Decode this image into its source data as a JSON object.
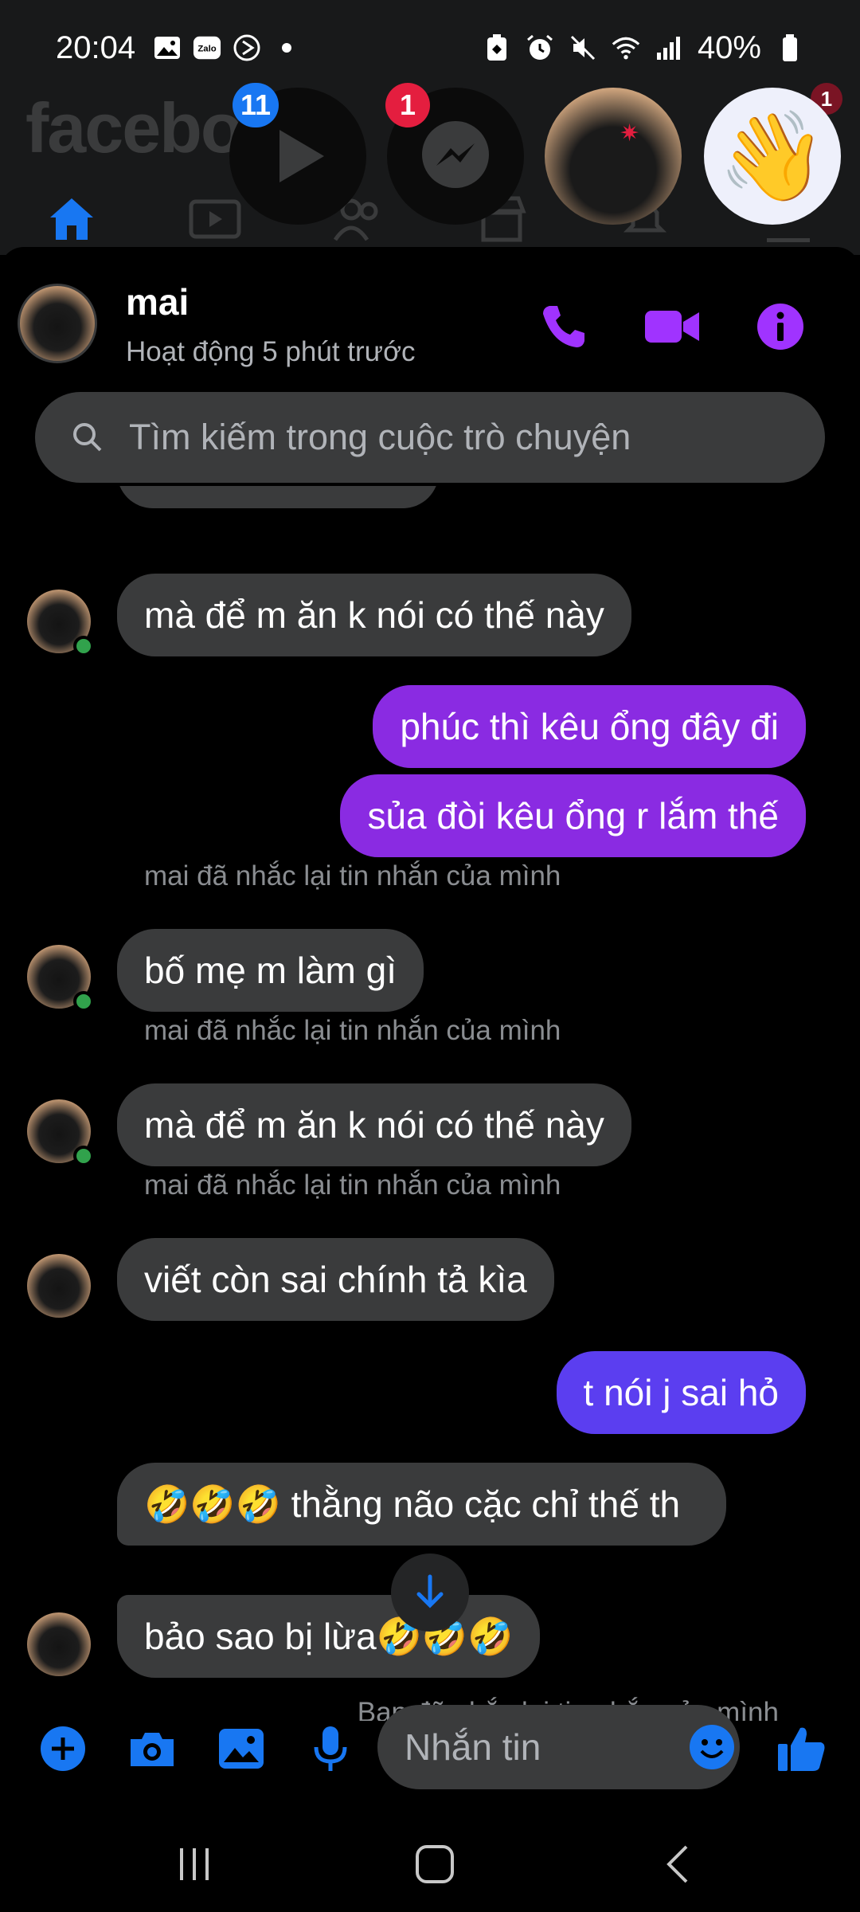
{
  "status_bar": {
    "time": "20:04",
    "battery": "40%",
    "left_icons": [
      "gallery-icon",
      "zalo-icon",
      "media-icon",
      "dot-icon"
    ],
    "right_icons": [
      "battery-saver-icon",
      "alarm-icon",
      "mute-icon",
      "wifi-icon",
      "signal-icon",
      "battery-icon"
    ]
  },
  "background_app": {
    "logo": "facebo",
    "nav_icons": [
      "home-icon",
      "video-icon",
      "friends-icon",
      "marketplace-icon",
      "bell-icon",
      "menu-icon"
    ],
    "notif_badge": "1"
  },
  "chat_heads": [
    {
      "icon": "play-icon",
      "badge": "11"
    },
    {
      "icon": "messenger-icon",
      "badge": "1"
    },
    {
      "icon": "cat-avatar"
    },
    {
      "icon": "wave-icon"
    }
  ],
  "header": {
    "name": "mai",
    "status": "Hoạt động 5 phút trước"
  },
  "search": {
    "placeholder": "Tìm kiếm trong cuộc trò chuyện"
  },
  "messages": [
    {
      "type": "in",
      "text": "mà để m ăn k nói có thế này"
    },
    {
      "type": "out",
      "text": "phúc thì kêu ổng đây đi"
    },
    {
      "type": "out",
      "text": "sủa đòi kêu ổng r lắm thế"
    },
    {
      "type": "note",
      "text": "mai đã nhắc lại tin nhắn của mình"
    },
    {
      "type": "in",
      "text": "bố mẹ m làm gì"
    },
    {
      "type": "note",
      "text": "mai đã nhắc lại tin nhắn của mình"
    },
    {
      "type": "in",
      "text": "mà để m ăn k nói có thế này"
    },
    {
      "type": "note",
      "text": "mai đã nhắc lại tin nhắn của mình"
    },
    {
      "type": "in",
      "text": "viết còn sai chính tả kìa"
    },
    {
      "type": "out",
      "text": "t nói j sai hỏ"
    },
    {
      "type": "in",
      "text": "🤣🤣🤣 thằng não cặc chỉ thế th"
    },
    {
      "type": "in",
      "text": "bảo sao bị lừa🤣🤣🤣"
    },
    {
      "type": "note",
      "text": "Bạn đã nhắc lại tin nhắn của mình"
    }
  ],
  "composer": {
    "placeholder": "Nhắn tin"
  },
  "colors": {
    "accent": "#8a2be2",
    "outgoing_blue": "#5b3ef0",
    "incoming": "#3a3b3c",
    "facebook_blue": "#1877f2"
  }
}
